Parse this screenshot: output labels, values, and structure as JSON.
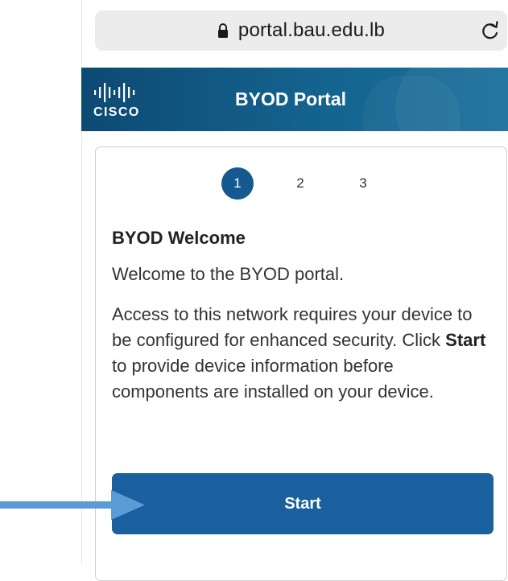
{
  "browser": {
    "url": "portal.bau.edu.lb",
    "lock_icon": "lock-icon",
    "reload_icon": "reload-icon"
  },
  "header": {
    "logo": "cisco",
    "title": "BYOD Portal",
    "colors": {
      "start": "#0d4a73",
      "end": "#1a6f9c"
    }
  },
  "steps": [
    {
      "label": "1",
      "active": true
    },
    {
      "label": "2",
      "active": false
    },
    {
      "label": "3",
      "active": false
    }
  ],
  "card": {
    "title": "BYOD Welcome",
    "welcome": "Welcome to the BYOD portal.",
    "body_before": "Access to this network requires your device to be configured for enhanced security. Click ",
    "body_bold": "Start",
    "body_after": " to provide device information before components are installed on your device.",
    "start_label": "Start"
  },
  "colors": {
    "accent": "#1a5f9e",
    "active_step": "#14598f",
    "annotation_arrow": "#5b9bd5"
  }
}
